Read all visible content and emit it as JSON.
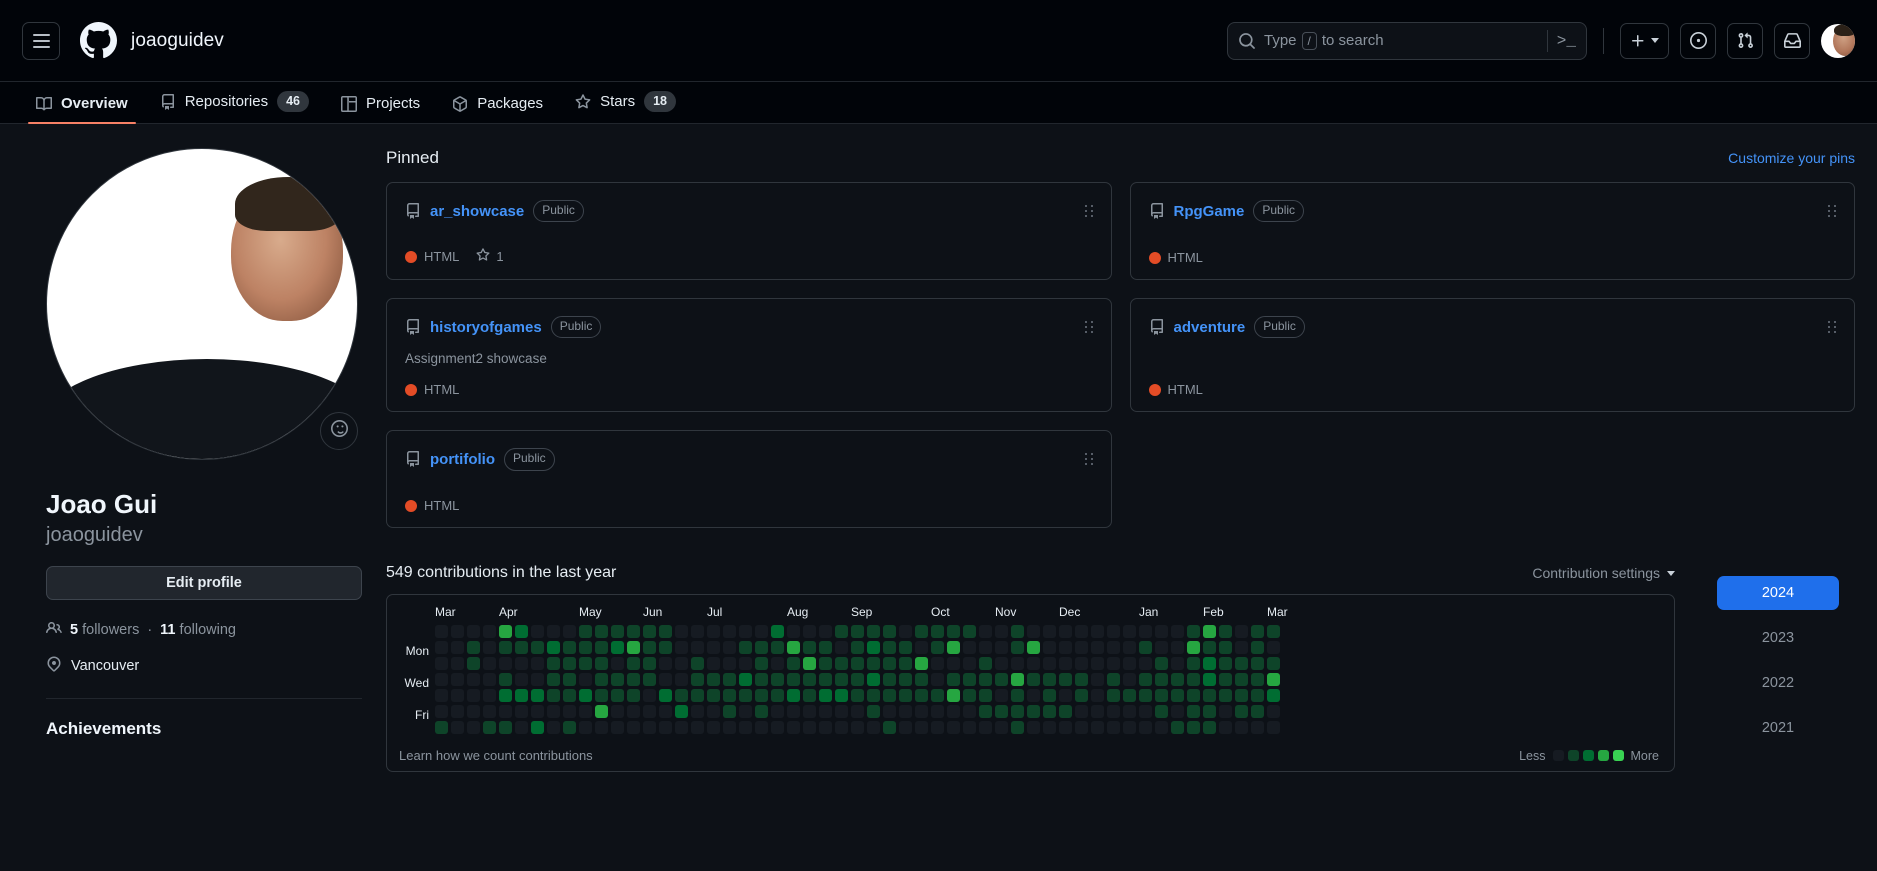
{
  "header": {
    "menu_label": "Open global navigation menu",
    "logo_name": "github-logo",
    "owner": "joaoguidev",
    "search": {
      "placeholder": "Type  /  to search",
      "slash_key": "/",
      "terminal_label": ">_"
    },
    "actions": [
      {
        "name": "create-new-button",
        "label": "+"
      },
      {
        "name": "issues-button",
        "label": ""
      },
      {
        "name": "pull-requests-button",
        "label": ""
      },
      {
        "name": "notifications-inbox-button",
        "label": ""
      }
    ],
    "avatar_label": "joaoguidev"
  },
  "nav": {
    "tabs": [
      {
        "label": "Overview",
        "icon": "book-icon",
        "count": null,
        "active": true
      },
      {
        "label": "Repositories",
        "icon": "repo-icon",
        "count": "46",
        "active": false
      },
      {
        "label": "Projects",
        "icon": "project-icon",
        "count": null,
        "active": false
      },
      {
        "label": "Packages",
        "icon": "package-icon",
        "count": null,
        "active": false
      },
      {
        "label": "Stars",
        "icon": "star-icon",
        "count": "18",
        "active": false
      }
    ]
  },
  "profile": {
    "status_icon": "smiley-icon",
    "full_name": "Joao Gui",
    "username": "joaoguidev",
    "edit_profile_label": "Edit profile",
    "followers_count": "5",
    "followers_label": "followers",
    "separator": "·",
    "following_count": "11",
    "following_label": "following",
    "location": "Vancouver",
    "achievements_title": "Achievements"
  },
  "pinned": {
    "title": "Pinned",
    "customize_label": "Customize your pins",
    "repos": [
      {
        "name": "ar_showcase",
        "visibility": "Public",
        "description": null,
        "language": "HTML",
        "language_color": "#e34c26",
        "stars": "1"
      },
      {
        "name": "RpgGame",
        "visibility": "Public",
        "description": null,
        "language": "HTML",
        "language_color": "#e34c26",
        "stars": null
      },
      {
        "name": "historyofgames",
        "visibility": "Public",
        "description": "Assignment2 showcase",
        "language": "HTML",
        "language_color": "#e34c26",
        "stars": null
      },
      {
        "name": "adventure",
        "visibility": "Public",
        "description": null,
        "language": "HTML",
        "language_color": "#e34c26",
        "stars": null
      },
      {
        "name": "portifolio",
        "visibility": "Public",
        "description": null,
        "language": "HTML",
        "language_color": "#e34c26",
        "stars": null
      }
    ]
  },
  "contributions": {
    "title": "549 contributions in the last year",
    "total": 549,
    "settings_label": "Contribution settings",
    "learn_label": "Learn how we count contributions",
    "legend": {
      "less": "Less",
      "more": "More"
    },
    "day_labels": [
      "",
      "Mon",
      "",
      "Wed",
      "",
      "Fri",
      ""
    ],
    "months": [
      "Mar",
      "Apr",
      "May",
      "Jun",
      "Jul",
      "Aug",
      "Sep",
      "Oct",
      "Nov",
      "Dec",
      "Jan",
      "Feb",
      "Mar"
    ],
    "month_week_index": [
      0,
      4,
      9,
      13,
      17,
      22,
      26,
      31,
      35,
      39,
      44,
      48,
      52
    ],
    "level_colors": [
      "#161b22",
      "#0e4429",
      "#006d32",
      "#26a641",
      "#39d353"
    ],
    "weeks": 53,
    "levels": [
      [
        0,
        0,
        0,
        0,
        0,
        0,
        1
      ],
      [
        0,
        0,
        0,
        0,
        0,
        0,
        0
      ],
      [
        0,
        1,
        1,
        0,
        0,
        0,
        0
      ],
      [
        0,
        0,
        0,
        0,
        0,
        0,
        1
      ],
      [
        3,
        1,
        0,
        1,
        2,
        0,
        1
      ],
      [
        2,
        1,
        0,
        0,
        2,
        0,
        0
      ],
      [
        0,
        1,
        0,
        0,
        2,
        0,
        2
      ],
      [
        0,
        2,
        1,
        1,
        1,
        0,
        0
      ],
      [
        0,
        1,
        1,
        1,
        1,
        0,
        1
      ],
      [
        1,
        1,
        1,
        0,
        2,
        0,
        0
      ],
      [
        1,
        1,
        1,
        1,
        1,
        3,
        0
      ],
      [
        1,
        2,
        0,
        1,
        1,
        0,
        0
      ],
      [
        1,
        3,
        1,
        1,
        1,
        0,
        0
      ],
      [
        1,
        1,
        1,
        1,
        0,
        0,
        0
      ],
      [
        1,
        1,
        0,
        0,
        2,
        0,
        0
      ],
      [
        0,
        0,
        0,
        0,
        1,
        2,
        0
      ],
      [
        0,
        0,
        1,
        1,
        1,
        0,
        0
      ],
      [
        0,
        0,
        0,
        1,
        1,
        0,
        0
      ],
      [
        0,
        0,
        0,
        1,
        1,
        1,
        0
      ],
      [
        0,
        1,
        0,
        2,
        1,
        0,
        0
      ],
      [
        0,
        1,
        1,
        1,
        1,
        1,
        0
      ],
      [
        2,
        1,
        0,
        1,
        1,
        0,
        0
      ],
      [
        0,
        3,
        1,
        1,
        2,
        0,
        0
      ],
      [
        0,
        1,
        3,
        1,
        1,
        0,
        0
      ],
      [
        0,
        1,
        1,
        1,
        2,
        0,
        0
      ],
      [
        1,
        0,
        1,
        1,
        2,
        0,
        0
      ],
      [
        1,
        1,
        1,
        1,
        1,
        0,
        0
      ],
      [
        1,
        2,
        1,
        2,
        1,
        1,
        0
      ],
      [
        1,
        1,
        1,
        1,
        1,
        0,
        1
      ],
      [
        0,
        1,
        1,
        1,
        1,
        0,
        0
      ],
      [
        1,
        0,
        3,
        1,
        1,
        0,
        0
      ],
      [
        1,
        1,
        0,
        0,
        1,
        0,
        0
      ],
      [
        1,
        3,
        0,
        1,
        3,
        0,
        0
      ],
      [
        1,
        0,
        0,
        1,
        1,
        0,
        0
      ],
      [
        0,
        0,
        1,
        1,
        1,
        1,
        0
      ],
      [
        0,
        0,
        0,
        1,
        0,
        1,
        0
      ],
      [
        1,
        1,
        0,
        3,
        1,
        1,
        1
      ],
      [
        0,
        3,
        0,
        1,
        0,
        1,
        0
      ],
      [
        0,
        0,
        0,
        1,
        1,
        1,
        0
      ],
      [
        0,
        0,
        0,
        1,
        0,
        1,
        0
      ],
      [
        0,
        0,
        0,
        1,
        1,
        0,
        0
      ],
      [
        0,
        0,
        0,
        0,
        0,
        0,
        0
      ],
      [
        0,
        0,
        0,
        1,
        1,
        0,
        0
      ],
      [
        0,
        0,
        0,
        0,
        1,
        0,
        0
      ],
      [
        0,
        1,
        0,
        1,
        1,
        0,
        0
      ],
      [
        0,
        0,
        1,
        1,
        1,
        1,
        0
      ],
      [
        0,
        0,
        0,
        1,
        1,
        0,
        1
      ],
      [
        1,
        3,
        1,
        1,
        1,
        1,
        1
      ],
      [
        3,
        1,
        2,
        2,
        1,
        1,
        1
      ],
      [
        1,
        1,
        1,
        1,
        1,
        0,
        0
      ],
      [
        0,
        0,
        1,
        1,
        1,
        1,
        0
      ],
      [
        1,
        1,
        1,
        1,
        1,
        1,
        0
      ],
      [
        1,
        0,
        1,
        3,
        2,
        0,
        0
      ]
    ],
    "years": [
      {
        "label": "2024",
        "selected": true
      },
      {
        "label": "2023",
        "selected": false
      },
      {
        "label": "2022",
        "selected": false
      },
      {
        "label": "2021",
        "selected": false
      }
    ]
  }
}
